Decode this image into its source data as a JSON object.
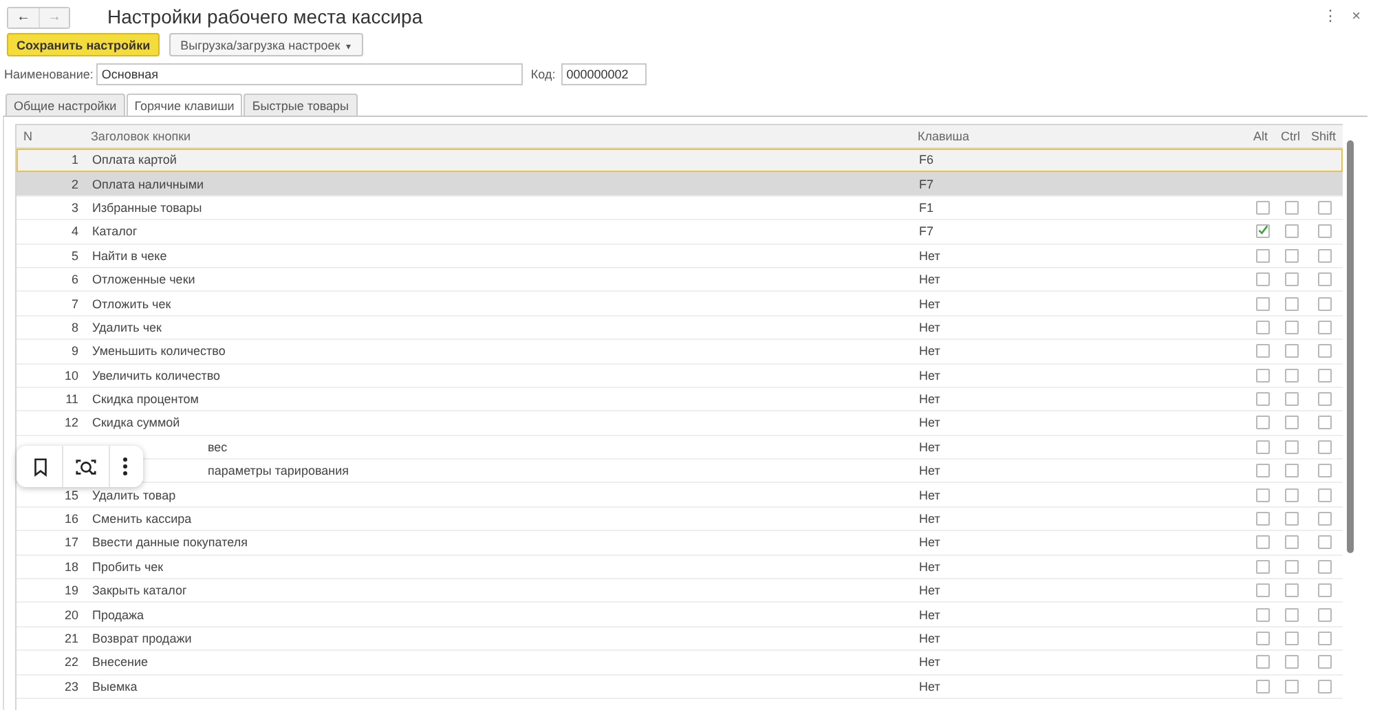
{
  "window": {
    "title": "Настройки рабочего места кассира",
    "menu_glyph": "⋮",
    "close_glyph": "×"
  },
  "nav": {
    "back": "←",
    "forward": "→"
  },
  "toolbar": [
    {
      "label": "Сохранить настройки",
      "kind": "primary"
    },
    {
      "label": "Выгрузка/загрузка настроек",
      "kind": "dropdown",
      "caret": "▾"
    }
  ],
  "fields": [
    {
      "label": "Наименование:",
      "value": "Основная",
      "kind": "wide"
    },
    {
      "label": "Код:",
      "value": "000000002",
      "kind": "narrow"
    }
  ],
  "tabs": [
    {
      "label": "Общие настройки",
      "selected": false
    },
    {
      "label": "Горячие клавиши",
      "selected": true
    },
    {
      "label": "Быстрые товары",
      "selected": false
    }
  ],
  "table": {
    "columns": [
      "N",
      "Заголовок кнопки",
      "Клавиша",
      "Alt",
      "Ctrl",
      "Shift"
    ],
    "rows": [
      {
        "n": "1",
        "title": "Оплата картой",
        "key": "F6",
        "focused": true,
        "selected": false
      },
      {
        "n": "2",
        "title": "Оплата наличными",
        "key": "F7",
        "focused": false,
        "selected": true
      },
      {
        "n": "3",
        "title": "Избранные товары",
        "key": "F1",
        "focused": false,
        "selected": false,
        "alt": false,
        "ctrl": false,
        "shift": false
      },
      {
        "n": "4",
        "title": "Каталог",
        "key": "F7",
        "focused": false,
        "selected": false,
        "alt": true,
        "ctrl": false,
        "shift": false
      },
      {
        "n": "5",
        "title": "Найти в чеке",
        "key": "Нет",
        "focused": false,
        "selected": false,
        "alt": false,
        "ctrl": false,
        "shift": false
      },
      {
        "n": "6",
        "title": "Отложенные чеки",
        "key": "Нет",
        "focused": false,
        "selected": false,
        "alt": false,
        "ctrl": false,
        "shift": false
      },
      {
        "n": "7",
        "title": "Отложить чек",
        "key": "Нет",
        "focused": false,
        "selected": false,
        "alt": false,
        "ctrl": false,
        "shift": false
      },
      {
        "n": "8",
        "title": "Удалить чек",
        "key": "Нет",
        "focused": false,
        "selected": false,
        "alt": false,
        "ctrl": false,
        "shift": false
      },
      {
        "n": "9",
        "title": "Уменьшить количество",
        "key": "Нет",
        "focused": false,
        "selected": false,
        "alt": false,
        "ctrl": false,
        "shift": false
      },
      {
        "n": "10",
        "title": "Увеличить количество",
        "key": "Нет",
        "focused": false,
        "selected": false,
        "alt": false,
        "ctrl": false,
        "shift": false
      },
      {
        "n": "11",
        "title": "Скидка процентом",
        "key": "Нет",
        "focused": false,
        "selected": false,
        "alt": false,
        "ctrl": false,
        "shift": false
      },
      {
        "n": "12",
        "title": "Скидка суммой",
        "key": "Нет",
        "focused": false,
        "selected": false,
        "alt": false,
        "ctrl": false,
        "shift": false
      },
      {
        "title": "вес",
        "covered": true,
        "key": "Нет",
        "focused": false,
        "selected": false,
        "alt": false,
        "ctrl": false,
        "shift": false
      },
      {
        "title": "параметры тарирования",
        "covered": true,
        "key": "Нет",
        "focused": false,
        "selected": false,
        "alt": false,
        "ctrl": false,
        "shift": false
      },
      {
        "n": "15",
        "title": "Удалить товар",
        "key": "Нет",
        "focused": false,
        "selected": false,
        "alt": false,
        "ctrl": false,
        "shift": false
      },
      {
        "n": "16",
        "title": "Сменить кассира",
        "key": "Нет",
        "focused": false,
        "selected": false,
        "alt": false,
        "ctrl": false,
        "shift": false
      },
      {
        "n": "17",
        "title": "Ввести данные покупателя",
        "key": "Нет",
        "focused": false,
        "selected": false,
        "alt": false,
        "ctrl": false,
        "shift": false
      },
      {
        "n": "18",
        "title": "Пробить чек",
        "key": "Нет",
        "focused": false,
        "selected": false,
        "alt": false,
        "ctrl": false,
        "shift": false
      },
      {
        "n": "19",
        "title": "Закрыть каталог",
        "key": "Нет",
        "focused": false,
        "selected": false,
        "alt": false,
        "ctrl": false,
        "shift": false
      },
      {
        "n": "20",
        "title": "Продажа",
        "key": "Нет",
        "focused": false,
        "selected": false,
        "alt": false,
        "ctrl": false,
        "shift": false
      },
      {
        "n": "21",
        "title": "Возврат продажи",
        "key": "Нет",
        "focused": false,
        "selected": false,
        "alt": false,
        "ctrl": false,
        "shift": false
      },
      {
        "n": "22",
        "title": "Внесение",
        "key": "Нет",
        "focused": false,
        "selected": false,
        "alt": false,
        "ctrl": false,
        "shift": false
      },
      {
        "n": "23",
        "title": "Выемка",
        "key": "Нет",
        "focused": false,
        "selected": false,
        "alt": false,
        "ctrl": false,
        "shift": false
      }
    ]
  }
}
